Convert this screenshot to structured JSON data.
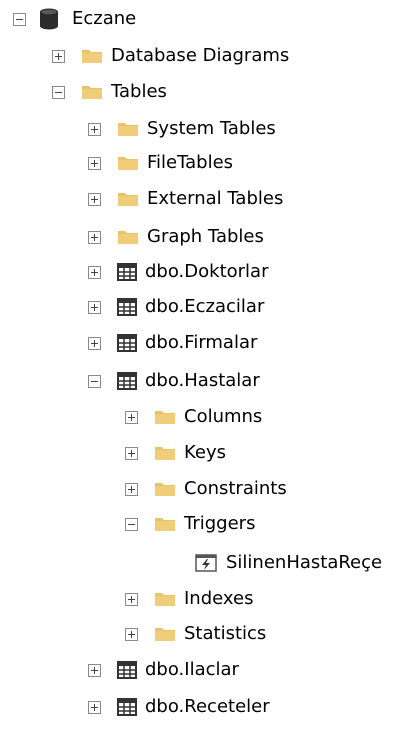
{
  "tree": {
    "root": {
      "label": "Eczane",
      "state": "expanded",
      "icon": "database-icon"
    },
    "database_diagrams": {
      "label": "Database Diagrams",
      "state": "collapsed",
      "icon": "folder-icon"
    },
    "tables": {
      "label": "Tables",
      "state": "expanded",
      "icon": "folder-icon",
      "folders": [
        {
          "label": "System Tables",
          "state": "collapsed",
          "icon": "folder-icon"
        },
        {
          "label": "FileTables",
          "state": "collapsed",
          "icon": "folder-icon"
        },
        {
          "label": "External Tables",
          "state": "collapsed",
          "icon": "folder-icon"
        },
        {
          "label": "Graph Tables",
          "state": "collapsed",
          "icon": "folder-icon"
        }
      ],
      "items": [
        {
          "label": "dbo.Doktorlar",
          "state": "collapsed",
          "icon": "table-icon"
        },
        {
          "label": "dbo.Eczacilar",
          "state": "collapsed",
          "icon": "table-icon"
        },
        {
          "label": "dbo.Firmalar",
          "state": "collapsed",
          "icon": "table-icon"
        },
        {
          "label": "dbo.Hastalar",
          "state": "expanded",
          "icon": "table-icon"
        },
        {
          "label": "dbo.Ilaclar",
          "state": "collapsed",
          "icon": "table-icon"
        },
        {
          "label": "dbo.Receteler",
          "state": "collapsed",
          "icon": "table-icon"
        }
      ],
      "hastalar_children": [
        {
          "label": "Columns",
          "state": "collapsed",
          "icon": "folder-icon"
        },
        {
          "label": "Keys",
          "state": "collapsed",
          "icon": "folder-icon"
        },
        {
          "label": "Constraints",
          "state": "collapsed",
          "icon": "folder-icon"
        },
        {
          "label": "Triggers",
          "state": "expanded",
          "icon": "folder-icon"
        },
        {
          "label": "Indexes",
          "state": "collapsed",
          "icon": "folder-icon"
        },
        {
          "label": "Statistics",
          "state": "collapsed",
          "icon": "folder-icon"
        }
      ],
      "trigger_item": {
        "label": "SilinenHastaReçe",
        "icon": "trigger-icon"
      }
    }
  },
  "colors": {
    "folder": "#e8c36a",
    "folder_dark": "#d4a843",
    "table_grid": "#333333",
    "database": "#2b2b2b",
    "toggle_border": "#8a8a8a"
  }
}
